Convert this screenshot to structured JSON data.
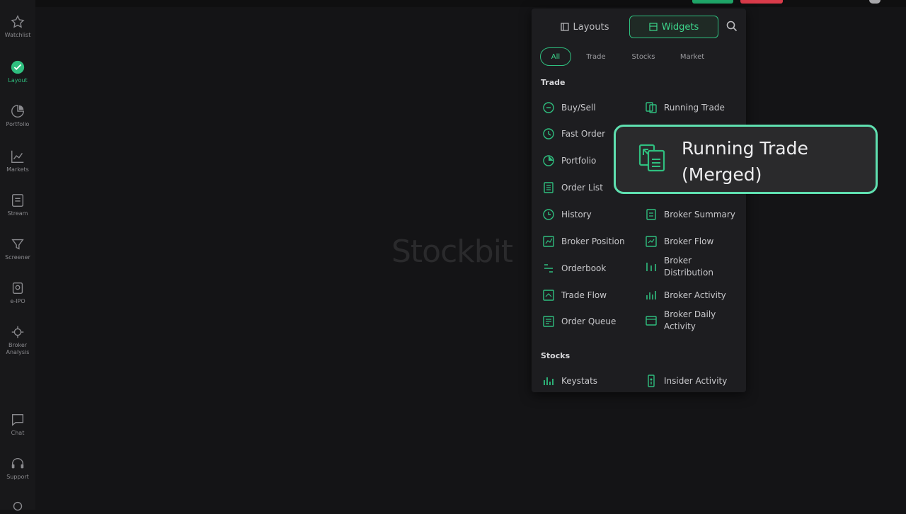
{
  "sidebar": {
    "items": [
      {
        "label": "Watchlist",
        "icon": "star-icon"
      },
      {
        "label": "Layout",
        "icon": "layout-icon",
        "active": true
      },
      {
        "label": "Portfolio",
        "icon": "pie-chart-icon"
      },
      {
        "label": "Markets",
        "icon": "chart-icon"
      },
      {
        "label": "Stream",
        "icon": "stream-icon"
      },
      {
        "label": "Screener",
        "icon": "filter-icon"
      },
      {
        "label": "e-IPO",
        "icon": "ipo-icon"
      },
      {
        "label": "Broker Analysis",
        "icon": "broker-analysis-icon"
      }
    ],
    "bottom_items": [
      {
        "label": "Chat",
        "icon": "chat-icon"
      },
      {
        "label": "Support",
        "icon": "headset-icon"
      }
    ]
  },
  "watermark": "Stockbit",
  "panel": {
    "tabs": {
      "layouts": "Layouts",
      "widgets": "Widgets"
    },
    "chips": [
      "All",
      "Trade",
      "Stocks",
      "Market"
    ],
    "sections": {
      "trade": "Trade",
      "stocks": "Stocks"
    },
    "trade_widgets_left": [
      "Buy/Sell",
      "Fast Order",
      "Portfolio",
      "Order List",
      "History",
      "Broker Position",
      "Orderbook",
      "Trade Flow",
      "Order Queue"
    ],
    "trade_widgets_right": [
      "Running Trade",
      "Broker Summary",
      "Broker Flow",
      "Broker Distribution",
      "Broker Activity",
      "Broker Daily Activity"
    ],
    "stocks_widgets": [
      "Keystats",
      "Insider Activity"
    ]
  },
  "callout": {
    "label": "Running Trade (Merged)"
  },
  "colors": {
    "accent": "#2fbf7f",
    "callout_border": "#5fe0b0",
    "background": "#141416"
  }
}
